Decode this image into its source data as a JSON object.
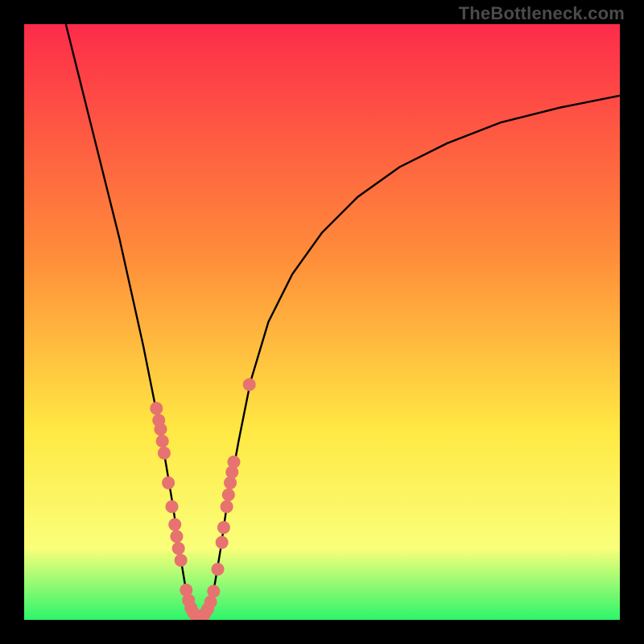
{
  "watermark": "TheBottleneck.com",
  "colors": {
    "gradient_top": "#fd2c4a",
    "gradient_mid1": "#ff8a3a",
    "gradient_mid2": "#ffe843",
    "gradient_mid3": "#faff7a",
    "gradient_bottom": "#2cf56b",
    "curve": "#000000",
    "dots": "#e6736f",
    "frame": "#000000"
  },
  "chart_data": {
    "type": "line",
    "title": "",
    "xlabel": "",
    "ylabel": "",
    "xlim": [
      0,
      100
    ],
    "ylim": [
      0,
      100
    ],
    "series": [
      {
        "name": "bottleneck-curve",
        "x": [
          7,
          10,
          13,
          16,
          18,
          20,
          22,
          23.5,
          25,
          26,
          27,
          28,
          29,
          30,
          31,
          32,
          33,
          34,
          36,
          38,
          41,
          45,
          50,
          56,
          63,
          71,
          80,
          90,
          100
        ],
        "y": [
          100,
          88,
          76,
          64,
          55,
          46,
          36,
          28,
          19,
          12,
          6,
          2,
          0.5,
          0.5,
          2,
          6,
          12,
          19,
          30,
          40,
          50,
          58,
          65,
          71,
          76,
          80,
          83.5,
          86,
          88
        ]
      }
    ],
    "points": [
      {
        "x": 22.2,
        "y": 35.5
      },
      {
        "x": 22.6,
        "y": 33.5
      },
      {
        "x": 22.9,
        "y": 32.0
      },
      {
        "x": 23.2,
        "y": 30.0
      },
      {
        "x": 23.5,
        "y": 28.0
      },
      {
        "x": 24.2,
        "y": 23.0
      },
      {
        "x": 24.8,
        "y": 19.0
      },
      {
        "x": 25.3,
        "y": 16.0
      },
      {
        "x": 25.6,
        "y": 14.0
      },
      {
        "x": 25.9,
        "y": 12.0
      },
      {
        "x": 26.3,
        "y": 10.0
      },
      {
        "x": 27.2,
        "y": 5.0
      },
      {
        "x": 27.6,
        "y": 3.3
      },
      {
        "x": 28.0,
        "y": 2.0
      },
      {
        "x": 28.4,
        "y": 1.2
      },
      {
        "x": 28.8,
        "y": 0.7
      },
      {
        "x": 29.3,
        "y": 0.5
      },
      {
        "x": 29.8,
        "y": 0.6
      },
      {
        "x": 30.3,
        "y": 1.0
      },
      {
        "x": 30.8,
        "y": 1.8
      },
      {
        "x": 31.3,
        "y": 3.0
      },
      {
        "x": 31.8,
        "y": 4.8
      },
      {
        "x": 32.5,
        "y": 8.5
      },
      {
        "x": 33.2,
        "y": 13.0
      },
      {
        "x": 33.5,
        "y": 15.5
      },
      {
        "x": 34.0,
        "y": 19.0
      },
      {
        "x": 34.3,
        "y": 21.0
      },
      {
        "x": 34.6,
        "y": 23.0
      },
      {
        "x": 34.9,
        "y": 24.8
      },
      {
        "x": 35.2,
        "y": 26.5
      },
      {
        "x": 37.8,
        "y": 39.5
      }
    ]
  }
}
